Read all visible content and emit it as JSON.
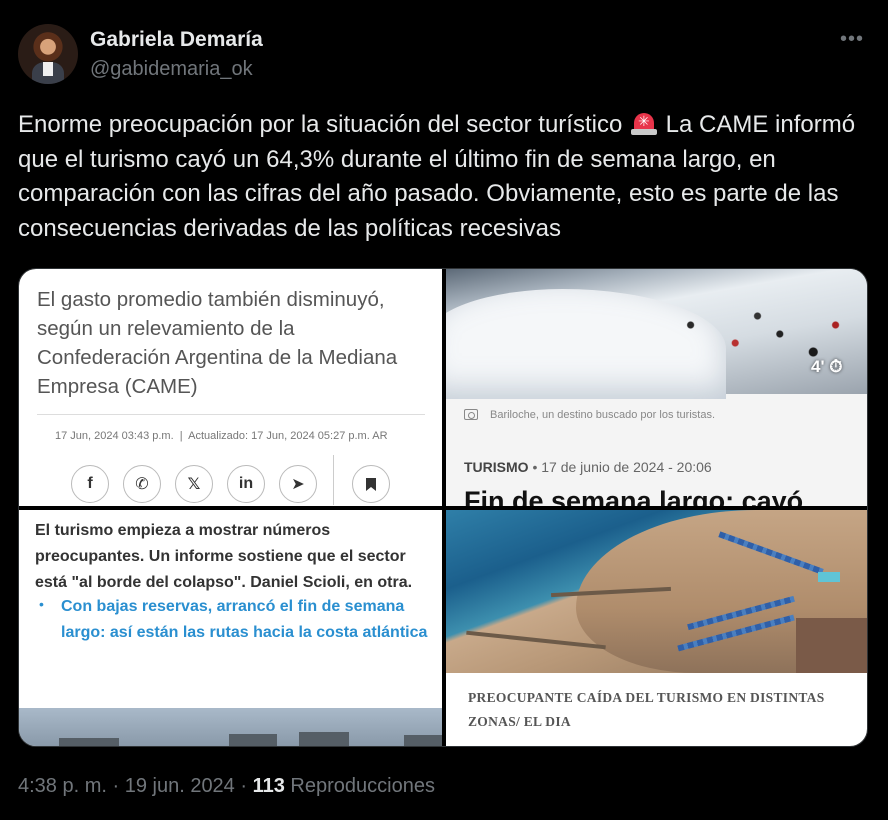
{
  "author": {
    "name": "Gabriela Demaría",
    "handle": "@gabidemaria_ok"
  },
  "more_icon": "ellipsis-icon",
  "tweet": {
    "text_before_emoji": "Enorme preocupación por la situación del sector turístico",
    "emoji": "siren-emoji",
    "text_after_emoji": " La CAME informó que el turismo cayó un 64,3% durante el último fin de semana largo, en comparación con las cifras del año pasado. Obviamente, esto es parte de las consecuencias derivadas de las políticas recesivas"
  },
  "media": {
    "image1": {
      "paragraph": "El gasto promedio también disminuyó, según un relevamiento de la Confederación Argentina de la Mediana Empresa (CAME)",
      "published": "17 Jun, 2024 03:43 p.m.",
      "separator": "|",
      "updated": "Actualizado: 17 Jun, 2024 05:27 p.m. AR",
      "share_buttons": [
        "facebook-icon",
        "whatsapp-icon",
        "x-icon",
        "linkedin-icon",
        "telegram-icon"
      ],
      "share_glyphs": [
        "f",
        "✆",
        "𝕏",
        "in",
        "➤"
      ],
      "bookmark_icon": "bookmark-icon"
    },
    "image2": {
      "timer_label": "4'",
      "caption": "Bariloche, un destino buscado por los turistas.",
      "section": "TURISMO",
      "date": "• 17 de junio de 2024 - 20:06",
      "headline": "Fin de semana largo: cayó"
    },
    "image3": {
      "paragraph": "El turismo empieza a mostrar números preocupantes. Un informe sostiene que el sector está \"al borde del colapso\". Daniel Scioli, en otra.",
      "bullet": "•",
      "link": "Con bajas reservas, arrancó el fin de semana largo: así están las rutas hacia la costa atlántica"
    },
    "image4": {
      "caption": "PREOCUPANTE CAÍDA DEL TURISMO EN DISTINTAS ZONAS/ EL DIA"
    }
  },
  "footer": {
    "time": "4:38 p. m. · 19 jun. 2024 · ",
    "views_count": "113",
    "views_label": " Reproducciones"
  },
  "colors": {
    "background": "#000000",
    "text": "#e7e9ea",
    "muted": "#71767b",
    "link_blue": "#2a8fd0"
  }
}
